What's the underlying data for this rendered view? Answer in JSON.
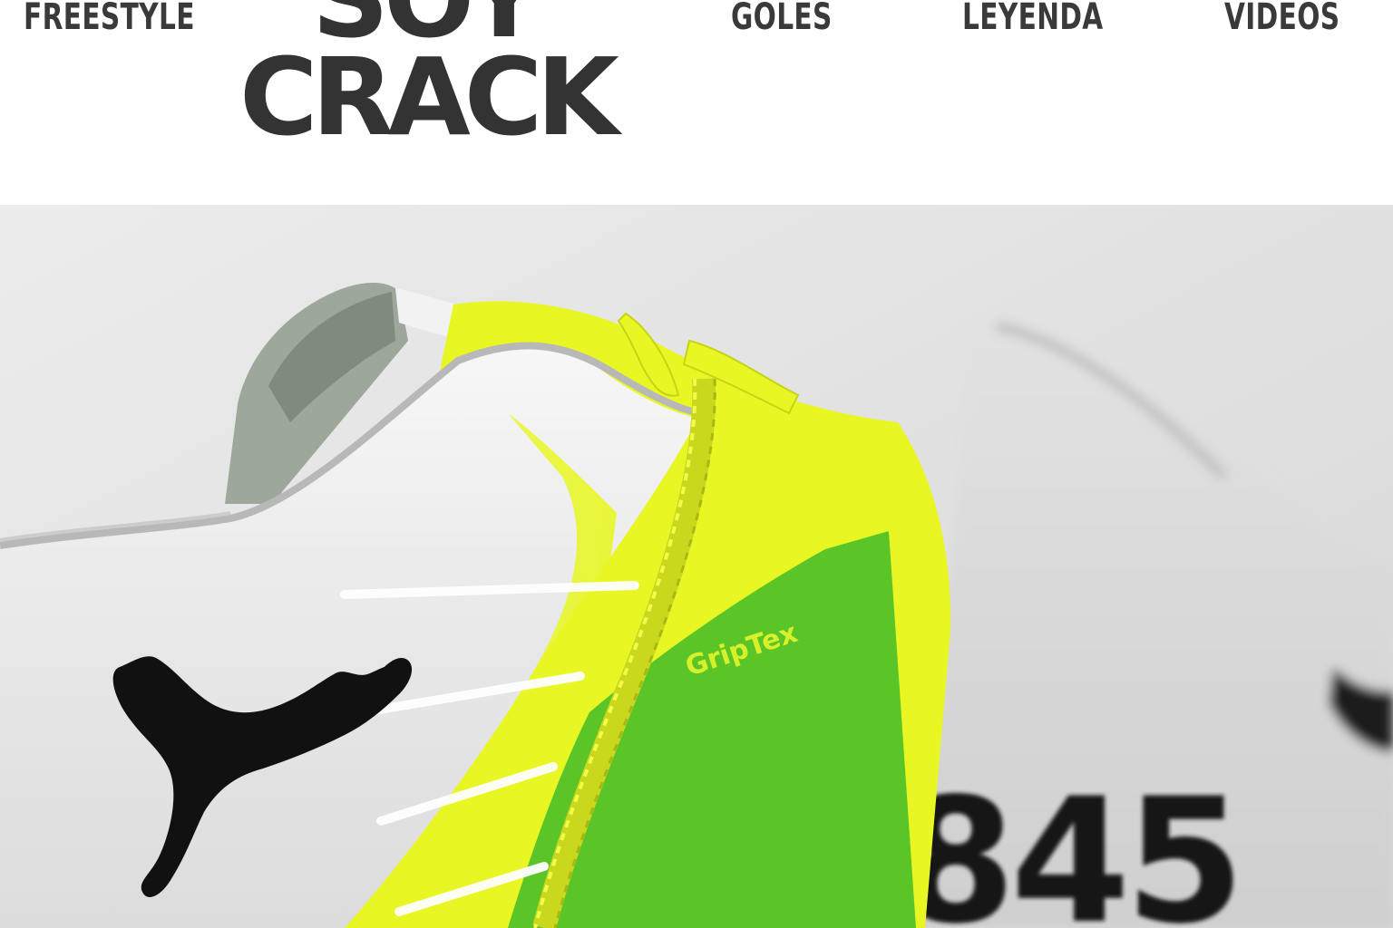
{
  "nav": {
    "freestyle": "FREESTYLE",
    "goles": "GOLES",
    "leyenda": "LEYENDA",
    "videos": "VIDEOS"
  },
  "logo": {
    "line1": "SOY",
    "line2": "CRACK"
  },
  "hero": {
    "material_label": "GripTex",
    "rear_number": "845",
    "brand_mark": "puma-cat-logo"
  },
  "colors": {
    "accent_yellow": "#e8f724",
    "accent_green": "#5bc528",
    "nav_text": "#3a3a3a",
    "logo_text": "#333333"
  }
}
